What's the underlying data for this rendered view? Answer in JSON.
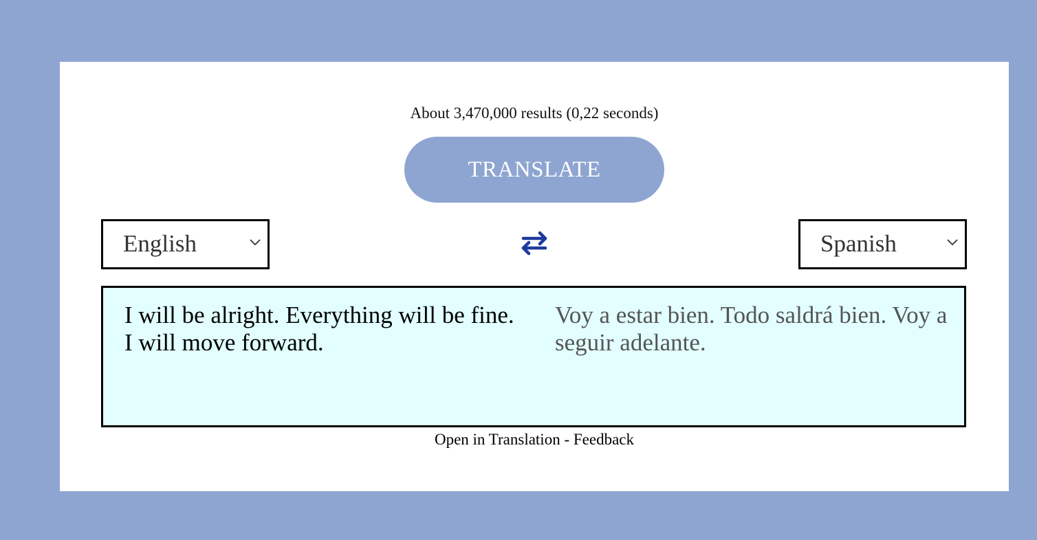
{
  "results_text": "About 3,470,000 results (0,22 seconds)",
  "translate_button": "TRANSLATE",
  "source_language": "English",
  "target_language": "Spanish",
  "swap_icon": "swap-arrows-icon",
  "source_text": "I will be alright. Everything will be fine. I will move forward.",
  "translated_text": "Voy a estar bien. Todo saldrá bien. Voy a seguir adelante.",
  "footer": {
    "open_link": "Open in Translation",
    "separator": " - ",
    "feedback_link": "Feedback"
  },
  "colors": {
    "page_background": "#8da5d0",
    "button_background": "#8da5d0",
    "swap_icon": "#1a3a9e",
    "text_box_background": "#e2fefe"
  }
}
